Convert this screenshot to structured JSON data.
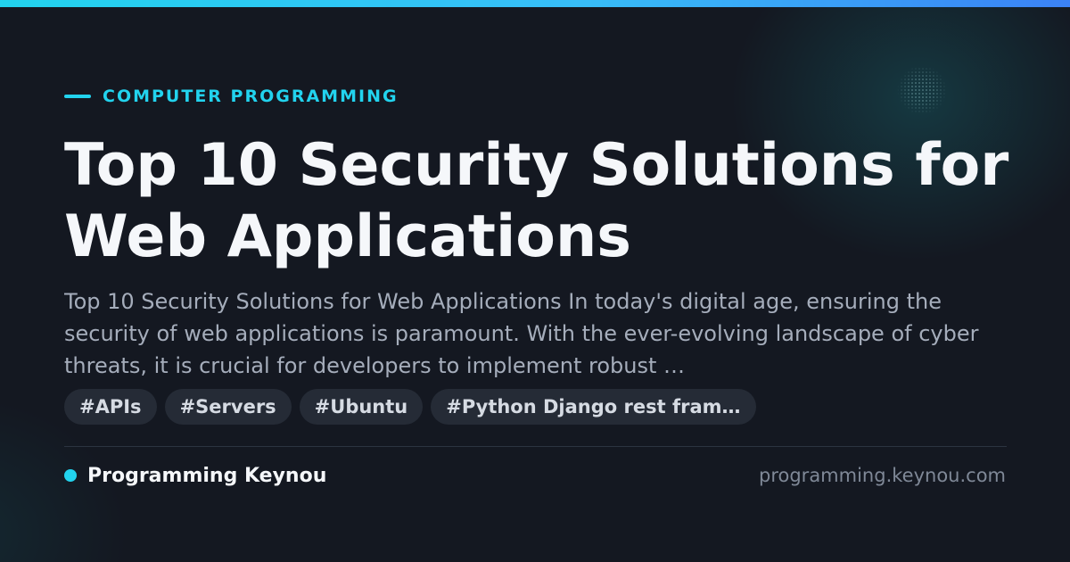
{
  "category": "COMPUTER PROGRAMMING",
  "title": "Top 10 Security Solutions for Web Applications",
  "excerpt": "Top 10 Security Solutions for Web Applications In today's digital age, ensuring the security of web applications is paramount. With the ever-evolving landscape of cyber threats, it is crucial for developers to implement robust …",
  "tags": [
    "#APIs",
    "#Servers",
    "#Ubuntu",
    "#Python Django rest fram…"
  ],
  "site": {
    "name": "Programming Keynou",
    "domain": "programming.keynou.com"
  },
  "colors": {
    "accent": "#22d3ee",
    "background": "#141821",
    "tag_background": "#252b36"
  },
  "icons": {
    "category_marker": "dash-icon",
    "brand_marker": "dot-icon"
  }
}
